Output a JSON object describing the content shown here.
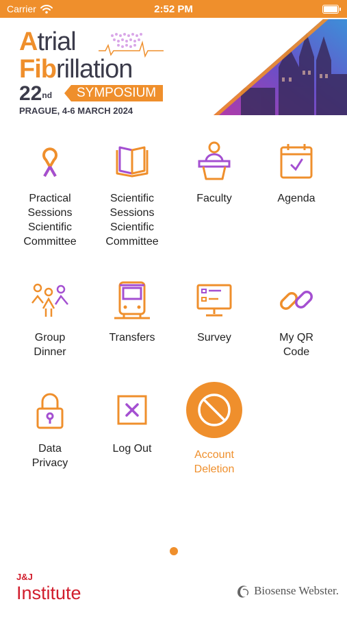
{
  "status": {
    "carrier": "Carrier",
    "time": "2:52 PM"
  },
  "logo": {
    "title_first_letter": "A",
    "title_rest": "trial",
    "title2_first": "Fib",
    "title2_rest": "rillation",
    "number": "22",
    "number_suffix": "nd",
    "ribbon": "SYMPOSIUM",
    "place": "PRAGUE, 4-6 MARCH 2024"
  },
  "menu": {
    "items": [
      {
        "label_lines": [
          "Practical",
          "Sessions",
          "Scientific",
          "Committee"
        ],
        "icon": "ribbon-icon"
      },
      {
        "label_lines": [
          "Scientific",
          "Sessions",
          "Scientific",
          "Committee"
        ],
        "icon": "book-icon"
      },
      {
        "label_lines": [
          "Faculty"
        ],
        "icon": "podium-speaker-icon"
      },
      {
        "label_lines": [
          "Agenda"
        ],
        "icon": "calendar-check-icon"
      },
      {
        "label_lines": [
          "Group",
          "Dinner"
        ],
        "icon": "group-people-icon"
      },
      {
        "label_lines": [
          "Transfers"
        ],
        "icon": "bus-icon"
      },
      {
        "label_lines": [
          "Survey"
        ],
        "icon": "monitor-survey-icon"
      },
      {
        "label_lines": [
          "My QR",
          "Code"
        ],
        "icon": "link-chain-icon"
      },
      {
        "label_lines": [
          "Data",
          "Privacy"
        ],
        "icon": "padlock-icon"
      },
      {
        "label_lines": [
          "Log Out"
        ],
        "icon": "close-box-icon"
      },
      {
        "label_lines": [
          "Account",
          "Deletion"
        ],
        "icon": "prohibited-icon"
      }
    ]
  },
  "footer": {
    "sponsor_small": "J&J",
    "sponsor_big": "Institute",
    "partner": "Biosense Webster."
  },
  "colors": {
    "accent": "#ef8f2c",
    "purple": "#a44fd1",
    "sponsor_red": "#d11d2c"
  }
}
